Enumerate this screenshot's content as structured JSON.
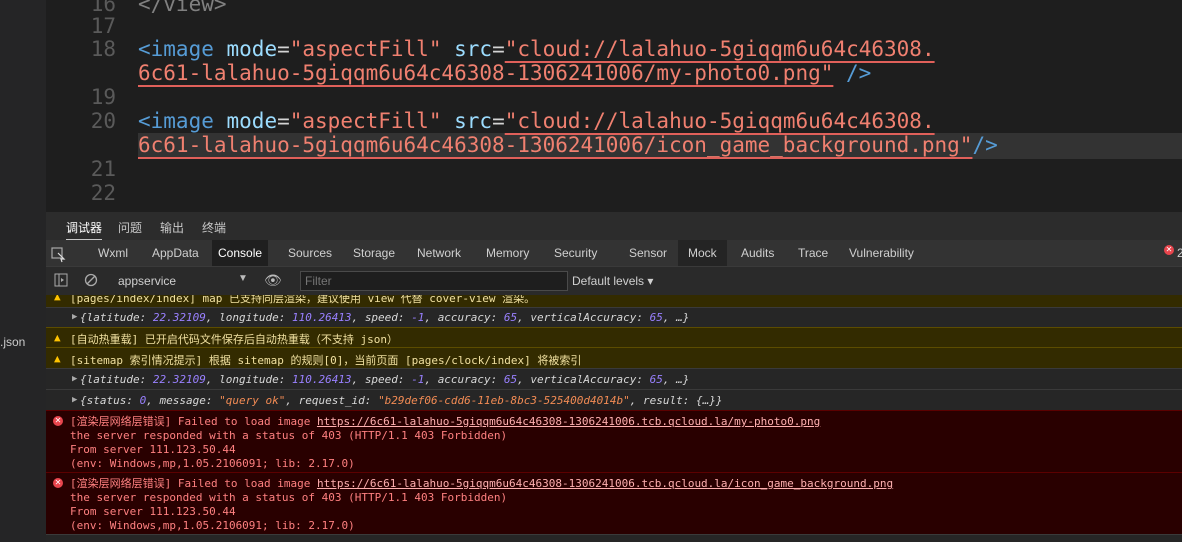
{
  "sidebar": {
    "file_suffix": ".json"
  },
  "editor": {
    "lines": [
      {
        "num": "16",
        "text": "</view>"
      },
      {
        "num": "17"
      },
      {
        "num": "18",
        "tag": "<image",
        "attr1": "mode",
        "val1": "\"aspectFill\"",
        "attr2": "src",
        "val2a": "\"cloud://lalahuo-5giqqm6u64c46308.",
        "val2b": "6c61-lalahuo-5giqqm6u64c46308-1306241006/my-photo0.png\"",
        "close": " />"
      },
      {
        "num": "19"
      },
      {
        "num": "20",
        "tag": "<image",
        "attr1": "mode",
        "val1": "\"aspectFill\"",
        "attr2": "src",
        "val2a": "\"cloud://lalahuo-5giqqm6u64c46308.",
        "val2b": "6c61-lalahuo-5giqqm6u64c46308-1306241006/icon_game_background.png\"",
        "close": "/>"
      },
      {
        "num": "21"
      },
      {
        "num": "22"
      }
    ]
  },
  "top_tabs": [
    "调试器",
    "问题",
    "输出",
    "终端"
  ],
  "dev_tabs": [
    "Wxml",
    "AppData",
    "Console",
    "Sources",
    "Storage",
    "Network",
    "Memory",
    "Security",
    "Sensor",
    "Mock",
    "Audits",
    "Trace",
    "Vulnerability"
  ],
  "error_count": "2",
  "filterbar": {
    "context": "appservice",
    "filter_placeholder": "Filter",
    "levels": "Default levels ▾"
  },
  "console": {
    "msg0": "[pages/index/index] map 已支持同层渲染，建议使用 view 代替 cover-view 渲染。",
    "loc1": {
      "lat_val": "22.32109",
      "lng_val": "110.26413",
      "speed_val": "-1",
      "acc_val": "65",
      "vacc_val": "65"
    },
    "msg2": "[自动热重载] 已开启代码文件保存后自动热重载（不支持 json）",
    "msg3": "[sitemap 索引情况提示] 根据 sitemap 的规则[0]，当前页面 [pages/clock/index] 将被索引",
    "status": {
      "status_val": "0",
      "message_val": "\"query ok\"",
      "request_val": "\"b29def06-cdd6-11eb-8bc3-525400d4014b\""
    },
    "err1": {
      "prefix": "[渲染层网络层错误] Failed to load image ",
      "url": "https://6c61-lalahuo-5giqqm6u64c46308-1306241006.tcb.qcloud.la/my-photo0.png",
      "line2": "the server responded with a status of 403 (HTTP/1.1 403 Forbidden)",
      "line3": "From server 111.123.50.44",
      "line4": "(env: Windows,mp,1.05.2106091; lib: 2.17.0)"
    },
    "err2": {
      "prefix": "[渲染层网络层错误] Failed to load image ",
      "url": "https://6c61-lalahuo-5giqqm6u64c46308-1306241006.tcb.qcloud.la/icon_game_background.png",
      "line2": "the server responded with a status of 403 (HTTP/1.1 403 Forbidden)",
      "line3": "From server 111.123.50.44",
      "line4": "(env: Windows,mp,1.05.2106091; lib: 2.17.0)"
    }
  }
}
